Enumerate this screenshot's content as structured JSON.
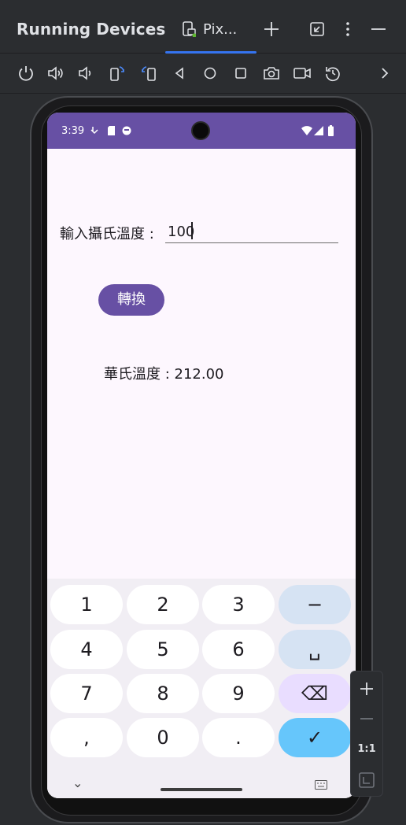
{
  "header": {
    "title": "Running Devices",
    "tab_label": "Pix...",
    "add_icon": "plus-icon",
    "restore_icon": "restore-window-icon",
    "more_icon": "more-vertical-icon",
    "minimize_icon": "minimize-icon"
  },
  "toolbar": {
    "icons": [
      "power-icon",
      "volume-up-icon",
      "volume-down-icon",
      "rotate-left-icon",
      "rotate-right-icon",
      "back-icon",
      "home-icon",
      "overview-icon",
      "camera-icon",
      "record-icon",
      "reset-icon",
      "chevron-right-icon"
    ]
  },
  "phone": {
    "status": {
      "time": "3:39"
    },
    "app": {
      "input_label": "輸入攝氏溫度 :",
      "input_value": "100",
      "convert_button": "轉換",
      "result_text": "華氏溫度 : 212.00"
    },
    "keyboard": {
      "keys": [
        "1",
        "2",
        "3",
        "−",
        "4",
        "5",
        "6",
        "␣",
        "7",
        "8",
        "9",
        "⌫",
        ",",
        "0",
        ".",
        "✓"
      ]
    }
  },
  "zoom": {
    "ratio_label": "1:1"
  },
  "colors": {
    "accent": "#6750a4",
    "ide_bg": "#2b2d30",
    "tab_underline": "#3574f0",
    "key_check": "#66c6fb"
  }
}
